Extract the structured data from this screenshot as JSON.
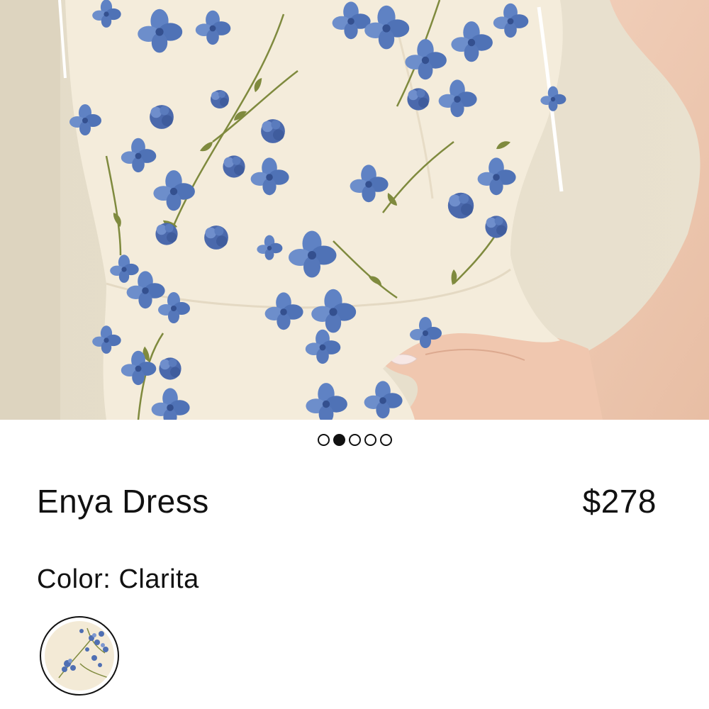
{
  "product": {
    "name": "Enya Dress",
    "price": "$278",
    "color_label": "Color:",
    "color_value": "Clarita"
  },
  "carousel": {
    "total_images": 5,
    "active_index": 1
  },
  "colors": {
    "fabric": "#f3ecdc",
    "wall": "#e6ddca",
    "flower_blue": "#5a7cc0",
    "flower_dark": "#3b5aa0",
    "leaf_green": "#7e8a3c",
    "skin": "#f0cbb3",
    "text": "#111111"
  }
}
